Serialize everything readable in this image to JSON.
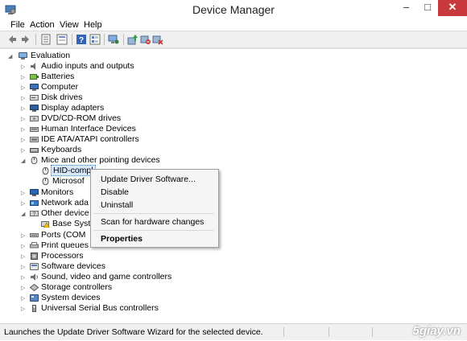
{
  "window": {
    "title": "Device Manager",
    "buttons": {
      "minimize": "–",
      "maximize": "□",
      "close": "✕"
    }
  },
  "menu": {
    "items": [
      "File",
      "Action",
      "View",
      "Help"
    ]
  },
  "toolbar": {
    "buttons": [
      "back-icon",
      "forward-icon",
      "properties-sheet-icon",
      "device-tree-icon",
      "help-icon",
      "list-icon",
      "computer-icon",
      "update-driver-icon",
      "disable-device-icon",
      "uninstall-device-icon",
      "scan-hardware-icon"
    ]
  },
  "tree": {
    "root": "Evaluation",
    "nodes": [
      "Audio inputs and outputs",
      "Batteries",
      "Computer",
      "Disk drives",
      "Display adapters",
      "DVD/CD-ROM drives",
      "Human Interface Devices",
      "IDE ATA/ATAPI controllers",
      "Keyboards",
      "Mice and other pointing devices",
      "HID-compl",
      "Microsof",
      "Monitors",
      "Network ada",
      "Other device",
      "Base Syst",
      "Ports (COM",
      "Print queues",
      "Processors",
      "Software devices",
      "Sound, video and game controllers",
      "Storage controllers",
      "System devices",
      "Universal Serial Bus controllers"
    ]
  },
  "context_menu": {
    "items": [
      "Update Driver Software...",
      "Disable",
      "Uninstall",
      "Scan for hardware changes",
      "Properties"
    ]
  },
  "statusbar": {
    "text": "Launches the Update Driver Software Wizard for the selected device."
  },
  "watermark": {
    "text": "5giay.vn"
  },
  "colors": {
    "close_button": "#c7393b",
    "selection": "#d7e8fb"
  }
}
